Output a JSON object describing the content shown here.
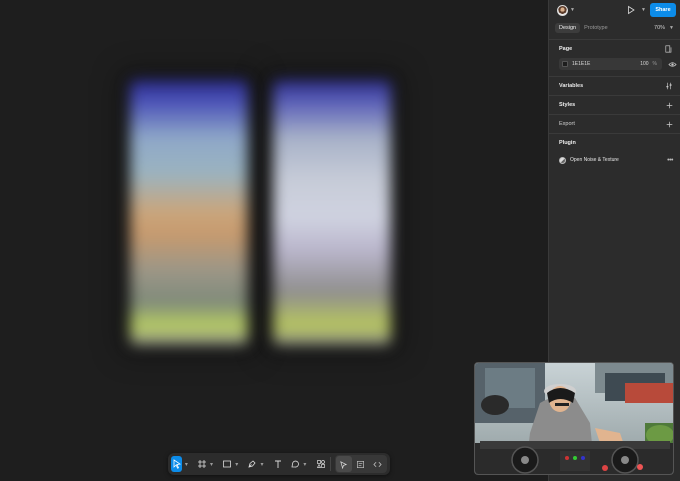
{
  "topbar": {
    "share_label": "Share"
  },
  "tabs": [
    {
      "label": "Design",
      "active": true
    },
    {
      "label": "Prototype",
      "active": false
    }
  ],
  "zoom": "70%",
  "page_section": {
    "title": "Page",
    "background_hex": "1E1E1E",
    "opacity": "100",
    "opacity_unit": "%"
  },
  "sections": {
    "variables": "Variables",
    "styles": "Styles",
    "export": "Export",
    "plugin": "Plugin"
  },
  "plugin": {
    "name": "Open Noise & Texture"
  },
  "toolbar": {
    "tools": [
      "move-tool",
      "frame-tool",
      "rectangle-tool",
      "pen-tool",
      "text-tool",
      "shape-tool",
      "actions-tool"
    ],
    "mode_group": [
      "design-mode",
      "dev-mode",
      "code-mode"
    ]
  },
  "colors": {
    "accent": "#0c8ce9",
    "canvas": "#1e1e1e",
    "panel": "#2c2c2c"
  }
}
